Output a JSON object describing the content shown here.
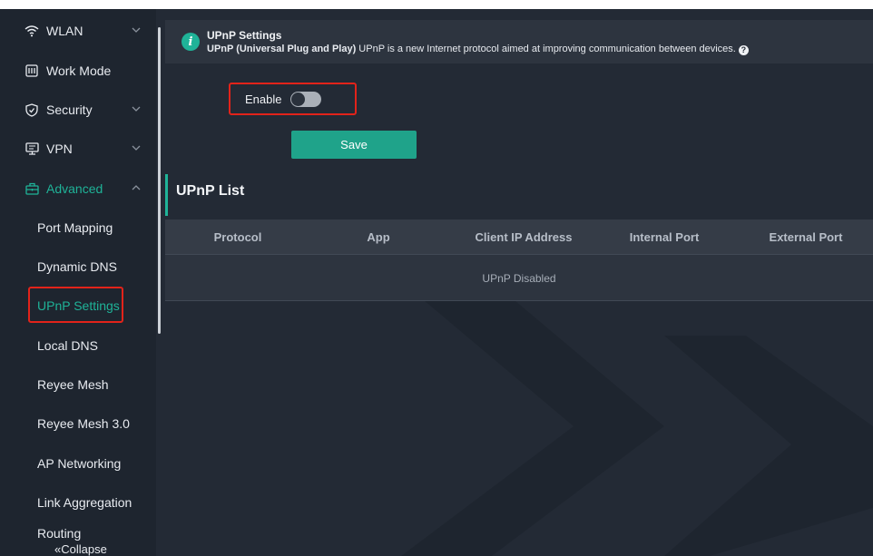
{
  "sidebar": {
    "items": [
      {
        "label": "WLAN",
        "icon": "wifi-icon",
        "has_chevron": true
      },
      {
        "label": "Work Mode",
        "icon": "work-mode-icon",
        "has_chevron": false
      },
      {
        "label": "Security",
        "icon": "shield-icon",
        "has_chevron": true
      },
      {
        "label": "VPN",
        "icon": "vpn-icon",
        "has_chevron": true
      },
      {
        "label": "Advanced",
        "icon": "advanced-icon",
        "has_chevron": true,
        "expanded": true
      }
    ],
    "sub_items": [
      {
        "label": "Port Mapping"
      },
      {
        "label": "Dynamic DNS"
      },
      {
        "label": "UPnP Settings",
        "selected": true
      },
      {
        "label": "Local DNS"
      },
      {
        "label": "Reyee Mesh"
      },
      {
        "label": "Reyee Mesh 3.0"
      },
      {
        "label": "AP Networking"
      },
      {
        "label": "Link Aggregation"
      },
      {
        "label": "Routing"
      }
    ],
    "collapse_label": "«Collapse"
  },
  "info": {
    "title": "UPnP Settings",
    "desc_bold": "UPnP  (Universal Plug and Play)",
    "desc_rest": " UPnP is a new Internet protocol aimed at improving communication between devices.",
    "icon": "info-icon"
  },
  "form": {
    "enable_label": "Enable",
    "enable_on": false,
    "save_label": "Save"
  },
  "list": {
    "title": "UPnP List",
    "columns": [
      "Protocol",
      "App",
      "Client IP Address",
      "Internal Port",
      "External Port"
    ],
    "empty_text": "UPnP Disabled"
  },
  "colors": {
    "accent": "#1fb398",
    "highlight": "#e2231a",
    "background": "#232a35"
  }
}
